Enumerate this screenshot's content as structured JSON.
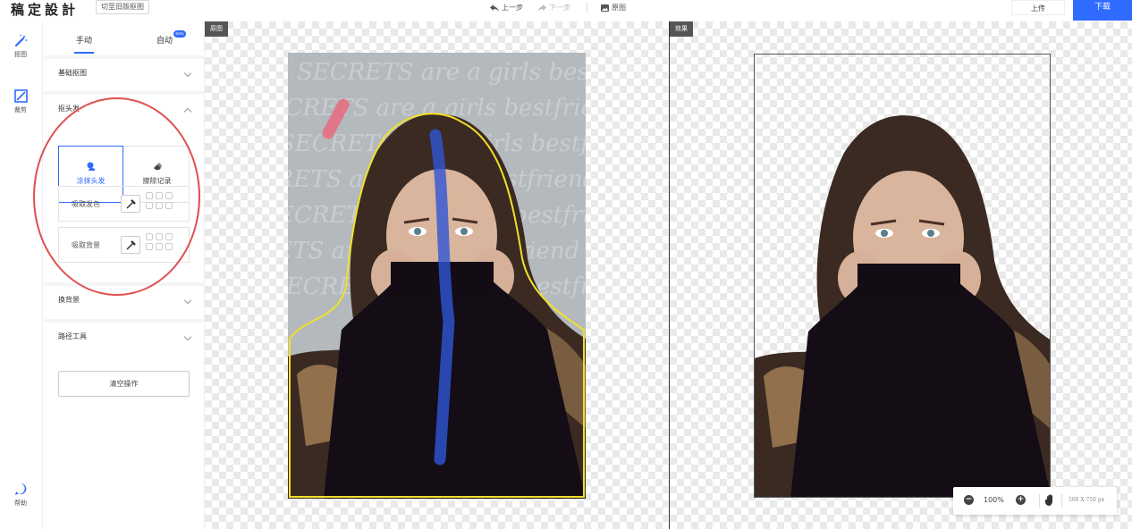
{
  "app": {
    "logo": "稿定設計",
    "old_version_button": "切至旧版抠图"
  },
  "toolbar": {
    "undo": "上一步",
    "redo": "下一步",
    "original": "原图",
    "upload": "上传",
    "download": "下载"
  },
  "rail": [
    {
      "label": "抠图",
      "icon": "magic-wand-icon"
    },
    {
      "label": "裁剪",
      "icon": "crop-icon"
    },
    {
      "label": "帮助",
      "icon": "help-icon"
    }
  ],
  "tabs": {
    "manual": "手动",
    "auto": "自动",
    "auto_badge": "beta"
  },
  "sections": {
    "basic": "基础抠图",
    "hair": "抠头发",
    "background": "换背景",
    "path": "路径工具"
  },
  "hair_tools": {
    "paint": "涂抹头发",
    "erase": "擦除记录"
  },
  "pick": {
    "hair_color": "吸取发色",
    "background": "吸取背景"
  },
  "clear": "清空操作",
  "canvas": {
    "left_tag": "原图",
    "right_tag": "效果",
    "watermark": "SECRETS are a girls bestfriend"
  },
  "zoom": {
    "level": "100%",
    "size": "500 X 750 px"
  },
  "colors": {
    "accent": "#2f6bff",
    "annotation_circle": "#e05050",
    "selection_outline": "#f0e02a"
  }
}
